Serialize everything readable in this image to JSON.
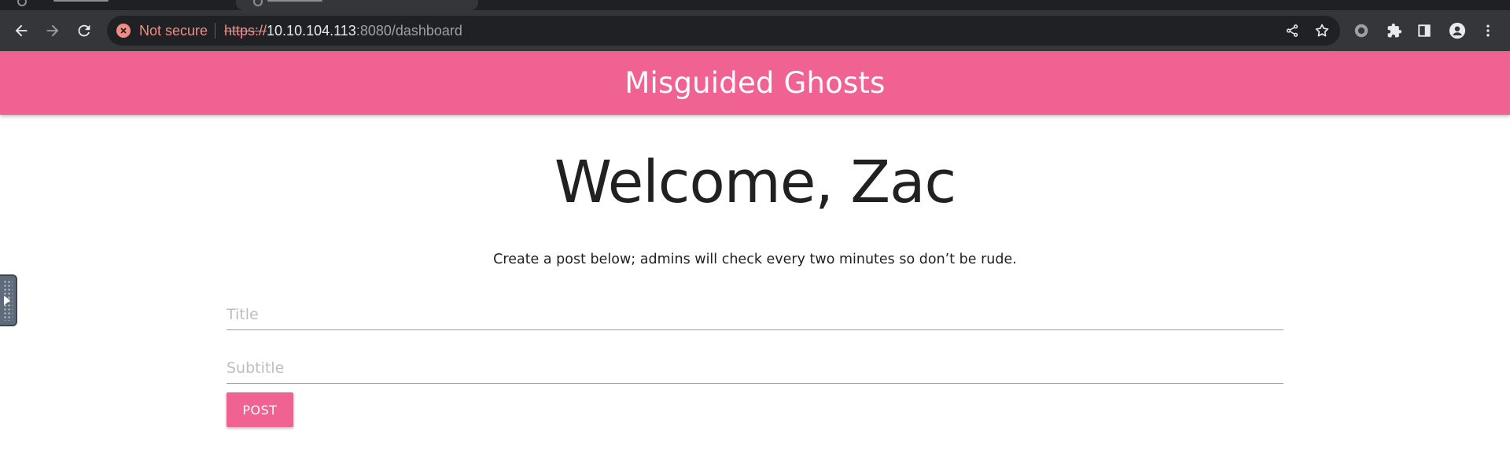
{
  "browser": {
    "security_label": "Not secure",
    "url_scheme": "https://",
    "url_host": "10.10.104.113",
    "url_rest": ":8080/dashboard",
    "icons": {
      "back": "arrow-left-icon",
      "forward": "arrow-right-icon",
      "reload": "reload-icon",
      "security": "not-secure-icon",
      "share": "share-icon",
      "bookmark": "star-icon",
      "extension1": "circle-extension-icon",
      "extensions": "puzzle-icon",
      "sidepanel": "side-panel-icon",
      "profile": "profile-icon",
      "menu": "kebab-menu-icon"
    }
  },
  "header": {
    "title": "Misguided Ghosts"
  },
  "main": {
    "welcome": "Welcome, Zac",
    "instructions": "Create a post below; admins will check every two minutes so don’t be rude.",
    "title_placeholder": "Title",
    "subtitle_placeholder": "Subtitle",
    "post_label": "POST"
  },
  "colors": {
    "accent": "#f06292",
    "toolbar": "#35363a",
    "warning": "#f28b82"
  }
}
